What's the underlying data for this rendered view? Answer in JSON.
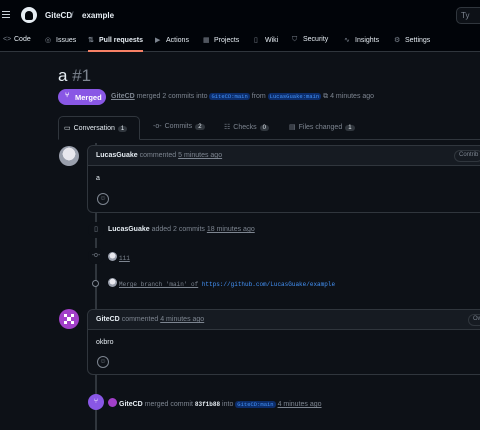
{
  "header": {
    "owner": "GiteCD",
    "separator": "/",
    "repo": "example",
    "search_hint": "Ty"
  },
  "repo_nav": [
    {
      "label": "Code",
      "icon": "code-icon",
      "glyph": "<>"
    },
    {
      "label": "Issues",
      "icon": "issue-icon",
      "glyph": "◎"
    },
    {
      "label": "Pull requests",
      "icon": "pull-request-icon",
      "glyph": "⇅"
    },
    {
      "label": "Actions",
      "icon": "play-icon",
      "glyph": "▶"
    },
    {
      "label": "Projects",
      "icon": "table-icon",
      "glyph": "▦"
    },
    {
      "label": "Wiki",
      "icon": "book-icon",
      "glyph": "▯"
    },
    {
      "label": "Security",
      "icon": "shield-icon",
      "glyph": "⛉"
    },
    {
      "label": "Insights",
      "icon": "graph-icon",
      "glyph": "∿"
    },
    {
      "label": "Settings",
      "icon": "gear-icon",
      "glyph": "⚙"
    }
  ],
  "pr": {
    "title": "a",
    "number": "#1",
    "state": "Merged",
    "author": "GiteCD",
    "merged_text": "merged 2 commits into",
    "base_branch": "GiteCD:main",
    "from_text": "from",
    "head_branch": "LucasGuake:main",
    "time": "4 minutes ago"
  },
  "pr_tabs": [
    {
      "label": "Conversation",
      "count": "1",
      "icon": "comment-icon"
    },
    {
      "label": "Commits",
      "count": "2",
      "icon": "commit-icon"
    },
    {
      "label": "Checks",
      "count": "0",
      "icon": "checklist-icon"
    },
    {
      "label": "Files changed",
      "count": "1",
      "icon": "file-diff-icon"
    }
  ],
  "timeline": {
    "comment1": {
      "author": "LucasGuake",
      "action": "commented",
      "time": "5 minutes ago",
      "role": "Contrib",
      "body": "a"
    },
    "added_event": {
      "author": "LucasGuake",
      "action": "added 2 commits",
      "time": "18 minutes ago"
    },
    "commits": [
      {
        "message": "111"
      },
      {
        "message": "Merge branch 'main' of",
        "link": "https://github.com/LucasGuake/example"
      }
    ],
    "comment2": {
      "author": "GiteCD",
      "action": "commented",
      "time": "4 minutes ago",
      "role": "Ow",
      "body": "okbro"
    },
    "merged_event": {
      "author": "GiteCD",
      "action": "merged commit",
      "sha": "83f1b88",
      "into": "into",
      "branch": "GiteCD:main",
      "time": "4 minutes ago"
    }
  },
  "colors": {
    "merged": "#8957e5",
    "active_tab_underline": "#f78166",
    "link": "#4493f8"
  }
}
